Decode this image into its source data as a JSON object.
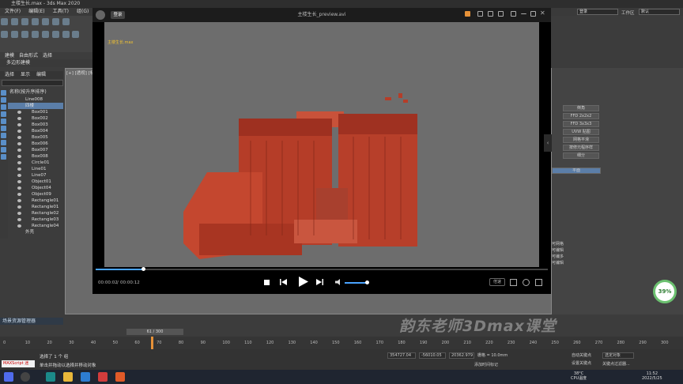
{
  "window": {
    "title": "主楼生长.max - 3ds Max 2020"
  },
  "menu": [
    "文件(F)",
    "编辑(E)",
    "工具(T)",
    "组(G)"
  ],
  "topright": {
    "login_text": "登录",
    "workspace_label": "工作区",
    "workspace_value": "默认"
  },
  "ribbon": {
    "tabs": [
      "建模",
      "自由形式",
      "选择"
    ],
    "subtitle": "多边形建模"
  },
  "scene_explorer": {
    "tabs": [
      "选择",
      "显示",
      "编辑"
    ],
    "header": "名称(按升序排序)",
    "items": [
      {
        "label": "Line008",
        "root": true
      },
      {
        "label": "四楼",
        "root": true,
        "selected": true
      },
      {
        "label": "Box001"
      },
      {
        "label": "Box002"
      },
      {
        "label": "Box003"
      },
      {
        "label": "Box004"
      },
      {
        "label": "Box005"
      },
      {
        "label": "Box006"
      },
      {
        "label": "Box007"
      },
      {
        "label": "Box008"
      },
      {
        "label": "Circle01"
      },
      {
        "label": "Line01"
      },
      {
        "label": "Line07"
      },
      {
        "label": "Object01"
      },
      {
        "label": "Object04"
      },
      {
        "label": "Object09"
      },
      {
        "label": "Rectangle01"
      },
      {
        "label": "Rectangle01"
      },
      {
        "label": "Rectangle02"
      },
      {
        "label": "Rectangle03"
      },
      {
        "label": "Rectangle04"
      },
      {
        "label": "外壳",
        "root": true
      }
    ],
    "footer": "场景资源管理器"
  },
  "viewport": {
    "label": "[+] [透视] [标"
  },
  "right_panel": {
    "buttons": [
      "倒角",
      "FFD 2x2x2",
      "FFD 3x3x3",
      "UVW 贴图",
      "网格平滑",
      "按修元程序样",
      "细分"
    ],
    "selected_item": "平面",
    "list_items": [
      "可网格",
      "可编辑",
      "可编多",
      "可编辑"
    ]
  },
  "player": {
    "title": "主楼生长_preview.avi",
    "login": "登录",
    "caption": "主楼生长.max",
    "time_current": "00:00:02",
    "time_total": "00:00:12",
    "progress_fraction": 0.105,
    "volume_fraction": 0.75,
    "speed_label": "倍速"
  },
  "timeline": {
    "frame_text": "61 / 300",
    "ticks": [
      "0",
      "10",
      "20",
      "30",
      "40",
      "50",
      "60",
      "70",
      "80",
      "90",
      "100",
      "110",
      "120",
      "130",
      "140",
      "150",
      "160",
      "170",
      "180",
      "190",
      "200",
      "210",
      "220",
      "230",
      "240",
      "250",
      "260",
      "270",
      "280",
      "290",
      "300"
    ],
    "current_frame": 61
  },
  "status": {
    "maxscript": "MAXScript 迷",
    "selection": "选择了 1 个 组",
    "hint": "单击并拖动以选择并移动对象",
    "x": "354727.04",
    "y": "-56010.05",
    "z": "20362.979",
    "grid": "栅格 = 10.0mm",
    "add_time_tag": "添加时间标记",
    "autokey": "自动关键点",
    "setkey": "设置关键点",
    "selected_obj": "选定对象",
    "filter": "关键点过滤器..."
  },
  "watermark": "韵东老师3Dmax课堂",
  "perf": {
    "percent": "39%"
  },
  "taskbar": {
    "temp": "38°C",
    "cpu": "CPU温度",
    "time": "11:52",
    "date": "2022/5/25"
  },
  "colors": {
    "accent": "#4aa3ff",
    "selection": "#5b7ea8",
    "building": "#c0452f",
    "timeline_mark": "#e69138"
  }
}
